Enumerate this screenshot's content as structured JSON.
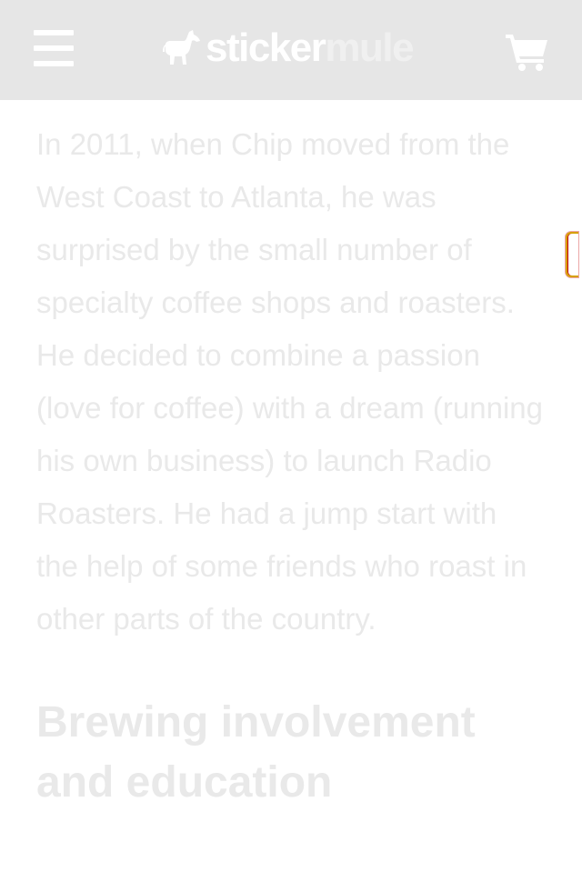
{
  "header": {
    "menu_icon": "hamburger-menu-icon",
    "logo": {
      "icon": "mule-icon",
      "part1": "sticker",
      "part2": "mule"
    },
    "cart_icon": "shopping-cart-icon"
  },
  "article": {
    "paragraph": "In 2011, when Chip moved from the West Coast to Atlanta, he was surprised by the small number of specialty coffee shops and roasters. He decided to combine a passion (love for coffee) with a dream (running his own business) to launch Radio Roasters. He had a jump start with the help of some friends who roast in other parts of the country.",
    "heading": "Brewing involvement and education"
  },
  "colors": {
    "header_bg": "#e6e6e6",
    "faded_text": "#e9e9e9",
    "indicator_border": "#d6a000"
  }
}
